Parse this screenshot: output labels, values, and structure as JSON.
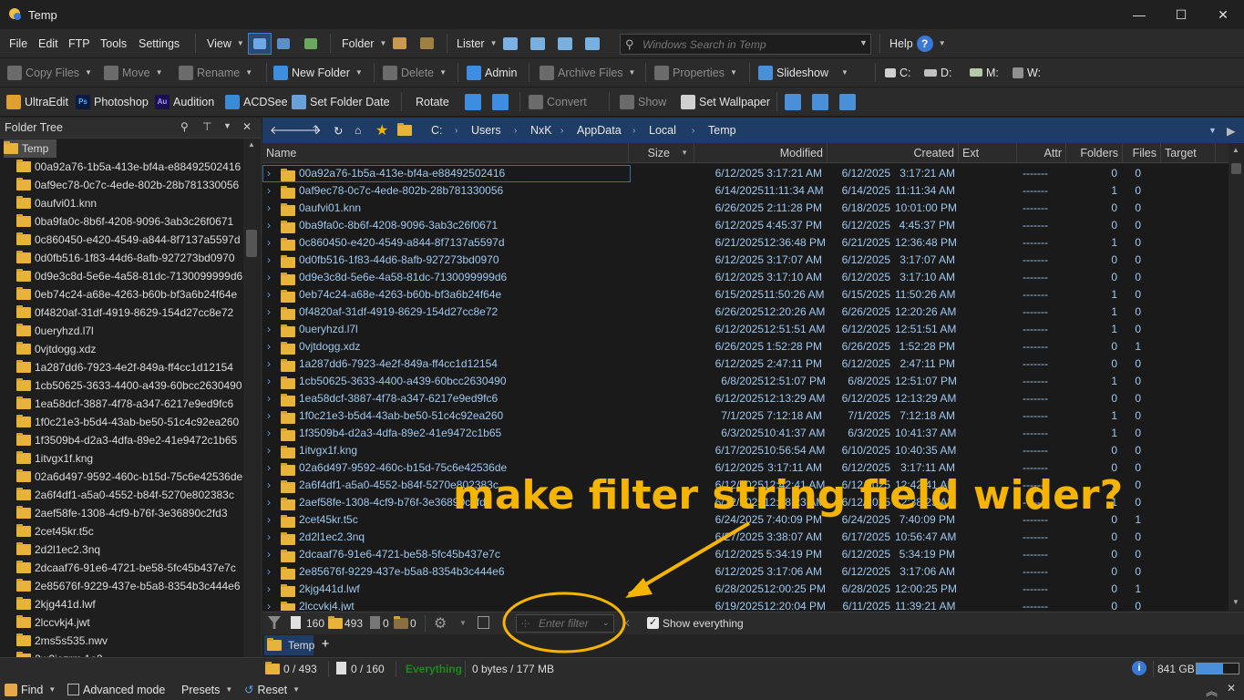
{
  "window": {
    "title": "Temp",
    "minimize": "—",
    "maximize": "☐",
    "close": "✕"
  },
  "menu": {
    "file": "File",
    "edit": "Edit",
    "ftp": "FTP",
    "tools": "Tools",
    "settings": "Settings",
    "view": "View",
    "folder": "Folder",
    "lister": "Lister",
    "search_placeholder": "Windows Search in Temp",
    "help": "Help",
    "help_glyph": "?"
  },
  "toolbar1": {
    "copy_files": "Copy Files",
    "move": "Move",
    "rename": "Rename",
    "new_folder": "New Folder",
    "delete": "Delete",
    "admin": "Admin",
    "archive_files": "Archive Files",
    "properties": "Properties",
    "slideshow": "Slideshow",
    "drive_c": "C:",
    "drive_d": "D:",
    "drive_m": "M:",
    "drive_w": "W:"
  },
  "toolbar2": {
    "ultraedit": "UltraEdit",
    "photoshop": "Photoshop",
    "ps_glyph": "Ps",
    "audition": "Audition",
    "au_glyph": "Au",
    "acdsee": "ACDSee",
    "set_folder_date": "Set Folder Date",
    "rotate": "Rotate",
    "convert": "Convert",
    "show": "Show",
    "set_wallpaper": "Set Wallpaper"
  },
  "foldertree": {
    "title": "Folder Tree",
    "root": "Temp",
    "items": [
      "00a92a76-1b5a-413e-bf4a-e88492502416",
      "0af9ec78-0c7c-4ede-802b-28b781330056",
      "0aufvi01.knn",
      "0ba9fa0c-8b6f-4208-9096-3ab3c26f0671",
      "0c860450-e420-4549-a844-8f7137a5597d",
      "0d0fb516-1f83-44d6-8afb-927273bd0970",
      "0d9e3c8d-5e6e-4a58-81dc-7130099999d6",
      "0eb74c24-a68e-4263-b60b-bf3a6b24f64e",
      "0f4820af-31df-4919-8629-154d27cc8e72",
      "0ueryhzd.l7l",
      "0vjtdogg.xdz",
      "1a287dd6-7923-4e2f-849a-ff4cc1d12154",
      "1cb50625-3633-4400-a439-60bcc2630490",
      "1ea58dcf-3887-4f78-a347-6217e9ed9fc6",
      "1f0c21e3-b5d4-43ab-be50-51c4c92ea260",
      "1f3509b4-d2a3-4dfa-89e2-41e9472c1b65",
      "1itvgx1f.kng",
      "02a6d497-9592-460c-b15d-75c6e42536de",
      "2a6f4df1-a5a0-4552-b84f-5270e802383c",
      "2aef58fe-1308-4cf9-b76f-3e36890c2fd3",
      "2cet45kr.t5c",
      "2d2l1ec2.3nq",
      "2dcaaf76-91e6-4721-be58-5fc45b437e7c",
      "2e85676f-9229-437e-b5a8-8354b3c444e6",
      "2kjg441d.lwf",
      "2lccvkj4.jwt",
      "2ms5s535.nwv",
      "2w2iozrm.1o3"
    ]
  },
  "address": {
    "path": [
      "C:",
      "Users",
      "NxK",
      "AppData",
      "Local",
      "Temp"
    ]
  },
  "columns": {
    "name": "Name",
    "size": "Size",
    "modified": "Modified",
    "created": "Created",
    "ext": "Ext",
    "attr": "Attr",
    "folders": "Folders",
    "files": "Files",
    "target": "Target"
  },
  "files": [
    {
      "name": "00a92a76-1b5a-413e-bf4a-e88492502416",
      "md": "6/12/2025",
      "mt": "3:17:21 AM",
      "cd": "6/12/2025",
      "ct": "3:17:21 AM",
      "attr": "-------",
      "folders": "0",
      "files": "0"
    },
    {
      "name": "0af9ec78-0c7c-4ede-802b-28b781330056",
      "md": "6/14/2025",
      "mt": "11:11:34 AM",
      "cd": "6/14/2025",
      "ct": "11:11:34 AM",
      "attr": "-------",
      "folders": "1",
      "files": "0"
    },
    {
      "name": "0aufvi01.knn",
      "md": "6/26/2025",
      "mt": "2:11:28 PM",
      "cd": "6/18/2025",
      "ct": "10:01:00 PM",
      "attr": "-------",
      "folders": "0",
      "files": "0"
    },
    {
      "name": "0ba9fa0c-8b6f-4208-9096-3ab3c26f0671",
      "md": "6/12/2025",
      "mt": "4:45:37 PM",
      "cd": "6/12/2025",
      "ct": "4:45:37 PM",
      "attr": "-------",
      "folders": "0",
      "files": "0"
    },
    {
      "name": "0c860450-e420-4549-a844-8f7137a5597d",
      "md": "6/21/2025",
      "mt": "12:36:48 PM",
      "cd": "6/21/2025",
      "ct": "12:36:48 PM",
      "attr": "-------",
      "folders": "1",
      "files": "0"
    },
    {
      "name": "0d0fb516-1f83-44d6-8afb-927273bd0970",
      "md": "6/12/2025",
      "mt": "3:17:07 AM",
      "cd": "6/12/2025",
      "ct": "3:17:07 AM",
      "attr": "-------",
      "folders": "0",
      "files": "0"
    },
    {
      "name": "0d9e3c8d-5e6e-4a58-81dc-7130099999d6",
      "md": "6/12/2025",
      "mt": "3:17:10 AM",
      "cd": "6/12/2025",
      "ct": "3:17:10 AM",
      "attr": "-------",
      "folders": "0",
      "files": "0"
    },
    {
      "name": "0eb74c24-a68e-4263-b60b-bf3a6b24f64e",
      "md": "6/15/2025",
      "mt": "11:50:26 AM",
      "cd": "6/15/2025",
      "ct": "11:50:26 AM",
      "attr": "-------",
      "folders": "1",
      "files": "0"
    },
    {
      "name": "0f4820af-31df-4919-8629-154d27cc8e72",
      "md": "6/26/2025",
      "mt": "12:20:26 AM",
      "cd": "6/26/2025",
      "ct": "12:20:26 AM",
      "attr": "-------",
      "folders": "1",
      "files": "0"
    },
    {
      "name": "0ueryhzd.l7l",
      "md": "6/12/2025",
      "mt": "12:51:51 AM",
      "cd": "6/12/2025",
      "ct": "12:51:51 AM",
      "attr": "-------",
      "folders": "1",
      "files": "0"
    },
    {
      "name": "0vjtdogg.xdz",
      "md": "6/26/2025",
      "mt": "1:52:28 PM",
      "cd": "6/26/2025",
      "ct": "1:52:28 PM",
      "attr": "-------",
      "folders": "0",
      "files": "1"
    },
    {
      "name": "1a287dd6-7923-4e2f-849a-ff4cc1d12154",
      "md": "6/12/2025",
      "mt": "2:47:11 PM",
      "cd": "6/12/2025",
      "ct": "2:47:11 PM",
      "attr": "-------",
      "folders": "0",
      "files": "0"
    },
    {
      "name": "1cb50625-3633-4400-a439-60bcc2630490",
      "md": "6/8/2025",
      "mt": "12:51:07 PM",
      "cd": "6/8/2025",
      "ct": "12:51:07 PM",
      "attr": "-------",
      "folders": "1",
      "files": "0"
    },
    {
      "name": "1ea58dcf-3887-4f78-a347-6217e9ed9fc6",
      "md": "6/12/2025",
      "mt": "12:13:29 AM",
      "cd": "6/12/2025",
      "ct": "12:13:29 AM",
      "attr": "-------",
      "folders": "0",
      "files": "0"
    },
    {
      "name": "1f0c21e3-b5d4-43ab-be50-51c4c92ea260",
      "md": "7/1/2025",
      "mt": "7:12:18 AM",
      "cd": "7/1/2025",
      "ct": "7:12:18 AM",
      "attr": "-------",
      "folders": "1",
      "files": "0"
    },
    {
      "name": "1f3509b4-d2a3-4dfa-89e2-41e9472c1b65",
      "md": "6/3/2025",
      "mt": "10:41:37 AM",
      "cd": "6/3/2025",
      "ct": "10:41:37 AM",
      "attr": "-------",
      "folders": "1",
      "files": "0"
    },
    {
      "name": "1itvgx1f.kng",
      "md": "6/17/2025",
      "mt": "10:56:54 AM",
      "cd": "6/10/2025",
      "ct": "10:40:35 AM",
      "attr": "-------",
      "folders": "0",
      "files": "0"
    },
    {
      "name": "02a6d497-9592-460c-b15d-75c6e42536de",
      "md": "6/12/2025",
      "mt": "3:17:11 AM",
      "cd": "6/12/2025",
      "ct": "3:17:11 AM",
      "attr": "-------",
      "folders": "0",
      "files": "0"
    },
    {
      "name": "2a6f4df1-a5a0-4552-b84f-5270e802383c",
      "md": "6/12/2025",
      "mt": "12:42:41 AM",
      "cd": "6/12/2025",
      "ct": "12:42:41 AM",
      "attr": "-------",
      "folders": "1",
      "files": "0"
    },
    {
      "name": "2aef58fe-1308-4cf9-b76f-3e36890c2fd3",
      "md": "6/12/2025",
      "mt": "12:38:23 AM",
      "cd": "6/12/2025",
      "ct": "12:38:23 AM",
      "attr": "-------",
      "folders": "1",
      "files": "0"
    },
    {
      "name": "2cet45kr.t5c",
      "md": "6/24/2025",
      "mt": "7:40:09 PM",
      "cd": "6/24/2025",
      "ct": "7:40:09 PM",
      "attr": "-------",
      "folders": "0",
      "files": "1"
    },
    {
      "name": "2d2l1ec2.3nq",
      "md": "6/27/2025",
      "mt": "3:38:07 AM",
      "cd": "6/17/2025",
      "ct": "10:56:47 AM",
      "attr": "-------",
      "folders": "0",
      "files": "0"
    },
    {
      "name": "2dcaaf76-91e6-4721-be58-5fc45b437e7c",
      "md": "6/12/2025",
      "mt": "5:34:19 PM",
      "cd": "6/12/2025",
      "ct": "5:34:19 PM",
      "attr": "-------",
      "folders": "0",
      "files": "0"
    },
    {
      "name": "2e85676f-9229-437e-b5a8-8354b3c444e6",
      "md": "6/12/2025",
      "mt": "3:17:06 AM",
      "cd": "6/12/2025",
      "ct": "3:17:06 AM",
      "attr": "-------",
      "folders": "0",
      "files": "0"
    },
    {
      "name": "2kjg441d.lwf",
      "md": "6/28/2025",
      "mt": "12:00:25 PM",
      "cd": "6/28/2025",
      "ct": "12:00:25 PM",
      "attr": "-------",
      "folders": "0",
      "files": "1"
    },
    {
      "name": "2lccvkj4.jwt",
      "md": "6/19/2025",
      "mt": "12:20:04 PM",
      "cd": "6/11/2025",
      "ct": "11:39:21 AM",
      "attr": "-------",
      "folders": "0",
      "files": "0"
    }
  ],
  "filterbar": {
    "file_count": "160",
    "folder_count": "493",
    "hidden_files": "0",
    "hidden_folders": "0",
    "filter_placeholder": "Enter filter",
    "show_everything": "Show everything",
    "clear_glyph": "✕"
  },
  "tabs": {
    "active": "Temp",
    "add": "+"
  },
  "status": {
    "folders_sel": "0 / 493",
    "files_sel": "0 / 160",
    "everything": "Everything",
    "bytes": "0 bytes / 177 MB",
    "disk_free": "841 GB",
    "disk_used_fraction": 0.62
  },
  "bottom": {
    "find": "Find",
    "advanced_mode": "Advanced mode",
    "presets": "Presets",
    "reset": "Reset"
  },
  "annotation": {
    "text": "make filter string field wider?"
  },
  "colors": {
    "accent": "#f5b400",
    "folder": "#e8b33a",
    "link": "#9ec8ee",
    "address": "#1f3c66"
  }
}
